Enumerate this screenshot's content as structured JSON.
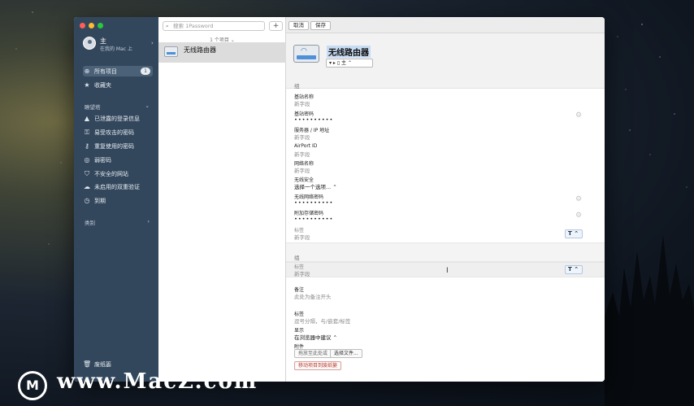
{
  "window": {
    "traffic": [
      "#ff5f57",
      "#febc2e",
      "#28c840"
    ]
  },
  "sidebar": {
    "account_name": "主",
    "account_sub": "在我的 Mac 上",
    "items": [
      {
        "icon": "grid-icon",
        "glyph": "⊕",
        "label": "所有项目",
        "badge": "1"
      },
      {
        "icon": "star-icon",
        "glyph": "★",
        "label": "收藏夹"
      }
    ],
    "watchtower_label": "瞭望塔",
    "watchtower_items": [
      {
        "icon": "warning-icon",
        "glyph": "▲",
        "label": "已泄露的登录信息"
      },
      {
        "icon": "key-icon",
        "glyph": "⚿",
        "label": "易受攻击的密码"
      },
      {
        "icon": "key-icon",
        "glyph": "⚷",
        "label": "重复使用的密码"
      },
      {
        "icon": "circle-icon",
        "glyph": "◎",
        "label": "弱密码"
      },
      {
        "icon": "shield-icon",
        "glyph": "⛉",
        "label": "不安全的网站"
      },
      {
        "icon": "cloud-icon",
        "glyph": "☁",
        "label": "未启用的双重验证"
      },
      {
        "icon": "clock-icon",
        "glyph": "◷",
        "label": "到期"
      }
    ],
    "category_label": "类别",
    "trash_label": "废纸篓"
  },
  "list": {
    "search_placeholder": "搜索 1Password",
    "count_label": "1 个项目 ⌄",
    "item_name": "无线路由器"
  },
  "toolbar": {
    "cancel_label": "取消",
    "save_label": "保存"
  },
  "detail": {
    "title": "无线路由器",
    "vault_label": "▾ ▸ ▯ 主 ⌃",
    "section_label": "组",
    "fields": [
      {
        "label": "基站名称",
        "value": "新字段",
        "kind": "placeholder"
      },
      {
        "label": "基站密码",
        "value": "••••••••••",
        "kind": "password"
      },
      {
        "label": "服务器 / IP 地址",
        "value": "新字段",
        "kind": "placeholder"
      },
      {
        "label": "AirPort ID",
        "value": "新字段",
        "kind": "placeholder"
      },
      {
        "label": "网络名称",
        "value": "新字段",
        "kind": "placeholder"
      },
      {
        "label": "无线安全",
        "value": "选择一个选项...  ⌃",
        "kind": "select"
      },
      {
        "label": "无线网络密码",
        "value": "••••••••••",
        "kind": "password"
      },
      {
        "label": "附加存储密码",
        "value": "••••••••••",
        "kind": "password"
      },
      {
        "label": "标签",
        "value": "新字段",
        "kind": "placeholder"
      }
    ],
    "section2_label": "组",
    "section2_field": {
      "label": "标签",
      "value": "新字段"
    },
    "type_badge": "T ⌃",
    "notes_label": "备注",
    "notes_placeholder": "此处为备注开头",
    "tags_label": "标签",
    "tags_placeholder": "逗号分隔，与/嵌套/标签",
    "display_label": "显示",
    "display_value": "在浏览器中建议  ⌃",
    "attachments_label": "附件",
    "drop_label": "拖放至此处或",
    "choose_file_label": "选择文件...",
    "move_trash_label": "移动项目到废纸篓"
  },
  "watermark": {
    "logo": "M",
    "text": "www.MacZ.com"
  }
}
